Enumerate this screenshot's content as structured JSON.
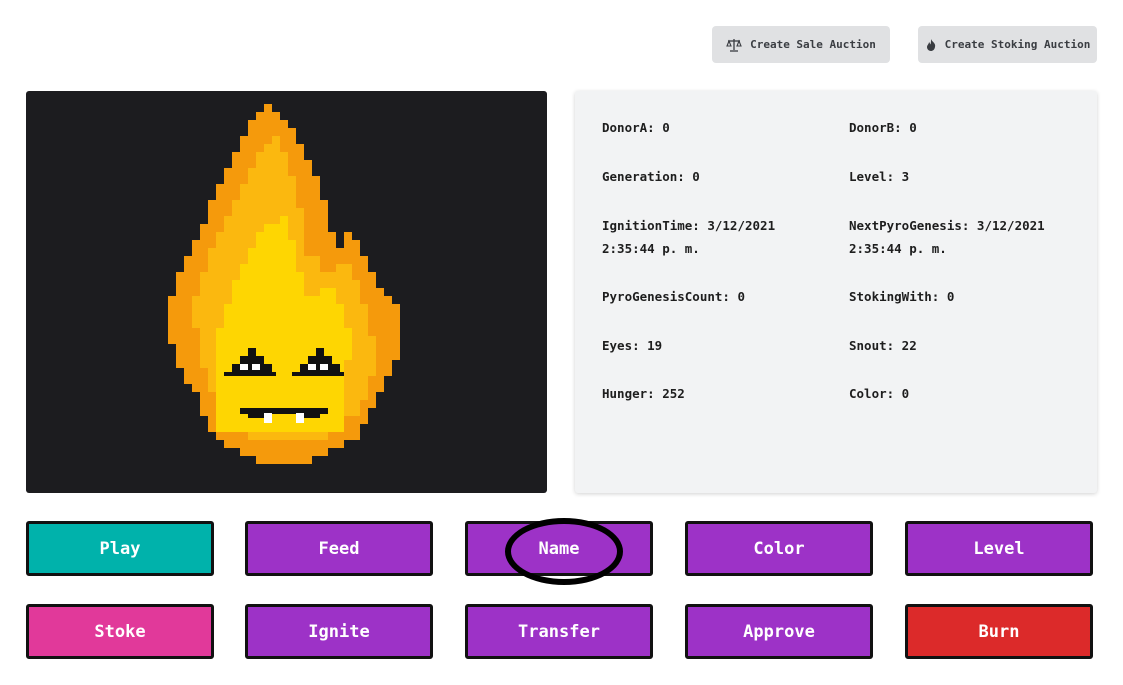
{
  "header": {
    "sale_auction_label": "Create Sale Auction",
    "stoking_auction_label": "Create Stoking Auction",
    "sale_icon": "scale-icon",
    "stoking_icon": "flame-icon"
  },
  "stats": {
    "donorA": "DonorA: 0",
    "donorB": "DonorB: 0",
    "generation": "Generation: 0",
    "level": "Level: 3",
    "ignition_time": "IgnitionTime: 3/12/2021 2:35:44 p. m.",
    "next_pyrogenesis": "NextPyroGenesis: 3/12/2021 2:35:44 p. m.",
    "pyrogenesis_count": "PyroGenesisCount: 0",
    "stoking_with": "StokingWith: 0",
    "eyes": "Eyes: 19",
    "snout": "Snout: 22",
    "hunger": "Hunger: 252",
    "color": "Color: 0"
  },
  "actions": {
    "play": "Play",
    "feed": "Feed",
    "name": "Name",
    "color": "Color",
    "level": "Level",
    "stoke": "Stoke",
    "ignite": "Ignite",
    "transfer": "Transfer",
    "approve": "Approve",
    "burn": "Burn"
  },
  "colors": {
    "primary_purple": "#9d32c7",
    "play_teal": "#00b2ab",
    "stoke_pink": "#e1399a",
    "burn_red": "#dc2a2a",
    "flame_outer": "#f59a0c",
    "flame_mid": "#fbb80f",
    "flame_inner": "#fed602",
    "art_background": "#1c1c1f"
  }
}
